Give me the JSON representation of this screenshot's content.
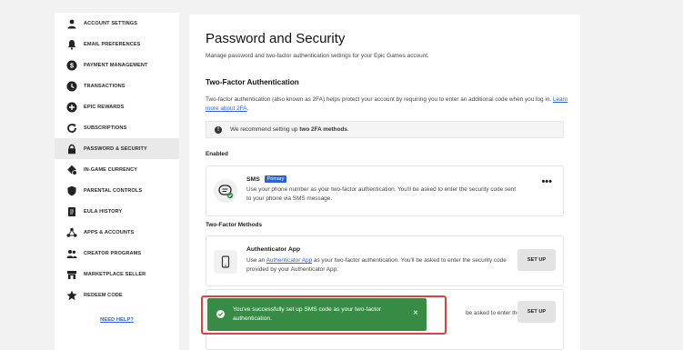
{
  "sidebar": {
    "items": [
      {
        "label": "ACCOUNT SETTINGS",
        "icon": "person-icon"
      },
      {
        "label": "EMAIL PREFERENCES",
        "icon": "bell-icon"
      },
      {
        "label": "PAYMENT MANAGEMENT",
        "icon": "dollar-icon"
      },
      {
        "label": "TRANSACTIONS",
        "icon": "clock-icon"
      },
      {
        "label": "EPIC REWARDS",
        "icon": "plus-circle-icon"
      },
      {
        "label": "SUBSCRIPTIONS",
        "icon": "refresh-icon"
      },
      {
        "label": "PASSWORD & SECURITY",
        "icon": "lock-icon"
      },
      {
        "label": "IN-GAME CURRENCY",
        "icon": "coins-icon"
      },
      {
        "label": "PARENTAL CONTROLS",
        "icon": "shield-icon"
      },
      {
        "label": "EULA HISTORY",
        "icon": "document-icon"
      },
      {
        "label": "APPS & ACCOUNTS",
        "icon": "apps-icon"
      },
      {
        "label": "CREATOR PROGRAMS",
        "icon": "people-icon"
      },
      {
        "label": "MARKETPLACE SELLER",
        "icon": "store-icon"
      },
      {
        "label": "REDEEM CODE",
        "icon": "star-icon"
      }
    ],
    "active_index": 6,
    "need_help": "NEED HELP?"
  },
  "main": {
    "title": "Password and Security",
    "subtitle": "Manage password and two-factor authentication settings for your Epic Games account.",
    "tfa_title": "Two-Factor Authentication",
    "tfa_desc": "Two-factor authentication (also known as 2FA) helps protect your account by requiring you to enter an additional code when you log in.",
    "tfa_link": "Learn more about 2FA",
    "tfa_link_end": ".",
    "recommend_prefix": "We recommend setting up ",
    "recommend_bold": "two 2FA methods",
    "recommend_suffix": ".",
    "enabled_label": "Enabled",
    "sms": {
      "title": "SMS",
      "badge": "Primary",
      "desc": "Use your phone number as your two-factor authentication. You'll be asked to enter the security code sent to your phone via SMS message.",
      "more": "•••"
    },
    "methods_label": "Two-Factor Methods",
    "auth_app": {
      "title": "Authenticator App",
      "desc_prefix": "Use an ",
      "desc_link": "Authenticator App",
      "desc_suffix": " as your two-factor authentication. You'll be asked to enter the security code provided by your Authenticator App.",
      "button": "SET UP"
    },
    "email_method": {
      "partial_desc": "be asked to enter the",
      "button": "SET UP"
    }
  },
  "toast": {
    "message": "You've successfully set up SMS code as your two-factor authentication.",
    "close": "×"
  },
  "colors": {
    "accent": "#2a63d8",
    "toast_bg": "#378b45",
    "highlight": "#d8433d"
  }
}
